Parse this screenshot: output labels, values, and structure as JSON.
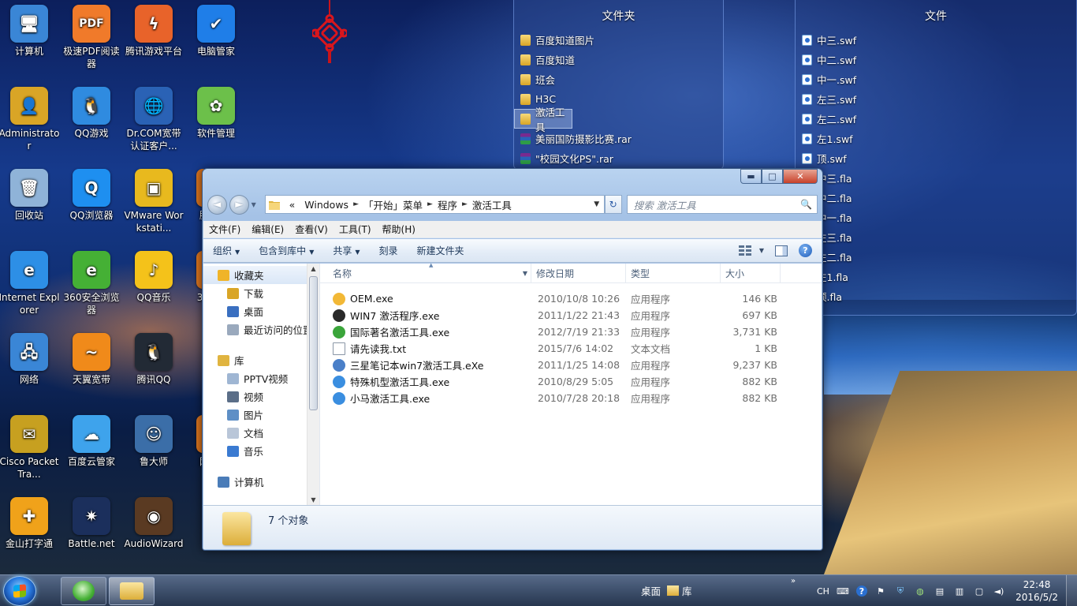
{
  "desktop": {
    "icons": [
      {
        "label": "计算机",
        "icon": "computer-icon",
        "color": "#3a86d6",
        "glyph": "🖥"
      },
      {
        "label": "极速PDF阅读器",
        "icon": "pdf-reader-icon",
        "color": "#f07a2a",
        "glyph": "PDF"
      },
      {
        "label": "腾讯游戏平台",
        "icon": "tencent-games-icon",
        "color": "#e8632a",
        "glyph": "ϟ"
      },
      {
        "label": "电脑管家",
        "icon": "pc-manager-icon",
        "color": "#1f7ee8",
        "glyph": "✔"
      },
      {
        "label": "Administrator",
        "icon": "user-folder-icon",
        "color": "#d9a526",
        "glyph": "👤"
      },
      {
        "label": "QQ游戏",
        "icon": "qq-game-icon",
        "color": "#2f8be0",
        "glyph": "🐧"
      },
      {
        "label": "Dr.COM宽带认证客户...",
        "icon": "drcom-icon",
        "color": "#2a62b5",
        "glyph": "🌐"
      },
      {
        "label": "软件管理",
        "icon": "software-manager-icon",
        "color": "#6cc04a",
        "glyph": "✿"
      },
      {
        "label": "回收站",
        "icon": "recycle-bin-icon",
        "color": "#8fb3d8",
        "glyph": "🗑"
      },
      {
        "label": "QQ浏览器",
        "icon": "qq-browser-icon",
        "color": "#1e8ff0",
        "glyph": "Q"
      },
      {
        "label": "VMware Workstati...",
        "icon": "vmware-icon",
        "color": "#e8b91e",
        "glyph": "▣"
      },
      {
        "label": "Internet Explorer",
        "icon": "ie-icon",
        "color": "#2d8fe6",
        "glyph": "e"
      },
      {
        "label": "360安全浏览器",
        "icon": "360-browser-icon",
        "color": "#45b035",
        "glyph": "e"
      },
      {
        "label": "QQ音乐",
        "icon": "qq-music-icon",
        "color": "#f4c21a",
        "glyph": "♪"
      },
      {
        "label": "网络",
        "icon": "network-icon",
        "color": "#3a86d6",
        "glyph": "🖧"
      },
      {
        "label": "天翼宽带",
        "icon": "tianyi-icon",
        "color": "#f08a1a",
        "glyph": "~"
      },
      {
        "label": "腾讯QQ",
        "icon": "qq-icon",
        "color": "#222a35",
        "glyph": "🐧"
      },
      {
        "label": "Cisco Packet Tra...",
        "icon": "packet-tracer-icon",
        "color": "#c7a020",
        "glyph": "✉"
      },
      {
        "label": "百度云管家",
        "icon": "baidu-cloud-icon",
        "color": "#3ea3ec",
        "glyph": "☁"
      },
      {
        "label": "鲁大师",
        "icon": "ludashi-icon",
        "color": "#3b6ea8",
        "glyph": "☺"
      },
      {
        "label": "金山打字通",
        "icon": "typing-icon",
        "color": "#f0a21a",
        "glyph": "✚"
      },
      {
        "label": "Battle.net",
        "icon": "battlenet-icon",
        "color": "#1b2f5c",
        "glyph": "✷"
      },
      {
        "label": "AudioWizard",
        "icon": "audiowizard-icon",
        "color": "#5a3a22",
        "glyph": "◉"
      }
    ],
    "partial_labels": [
      "腾",
      "36",
      "网"
    ]
  },
  "stack_folders": {
    "title": "文件夹",
    "items": [
      {
        "label": "百度知道图片",
        "type": "folder"
      },
      {
        "label": "百度知道",
        "type": "folder"
      },
      {
        "label": "班会",
        "type": "folder"
      },
      {
        "label": "H3C",
        "type": "folder"
      },
      {
        "label": "激活工具",
        "type": "folder",
        "selected": true
      },
      {
        "label": "美丽国防摄影比赛.rar",
        "type": "rar"
      },
      {
        "label": "\"校园文化PS\".rar",
        "type": "rar"
      }
    ]
  },
  "stack_files": {
    "title": "文件",
    "items": [
      {
        "label": "中三.swf"
      },
      {
        "label": "中二.swf"
      },
      {
        "label": "中一.swf"
      },
      {
        "label": "左三.swf"
      },
      {
        "label": "左二.swf"
      },
      {
        "label": "左1.swf"
      },
      {
        "label": "顶.swf"
      },
      {
        "label": "中三.fla"
      },
      {
        "label": "中二.fla"
      },
      {
        "label": "中一.fla"
      },
      {
        "label": "左三.fla"
      },
      {
        "label": "左二.fla"
      },
      {
        "label": "左1.fla"
      },
      {
        "label": "顶.fla"
      }
    ]
  },
  "explorer": {
    "window_controls": {
      "minimize": "▬",
      "maximize": "□",
      "close": "✕"
    },
    "nav": {
      "back": "◄",
      "forward": "►",
      "history": "▼"
    },
    "address": {
      "prefix": "«",
      "crumbs": [
        "Windows",
        "「开始」菜单",
        "程序",
        "激活工具"
      ],
      "separator": "►",
      "dropdown": "▼",
      "refresh": "↻"
    },
    "search": {
      "placeholder": "搜索 激活工具",
      "icon": "🔍"
    },
    "menu": [
      "文件(F)",
      "编辑(E)",
      "查看(V)",
      "工具(T)",
      "帮助(H)"
    ],
    "commands": [
      {
        "label": "组织",
        "dropdown": true
      },
      {
        "label": "包含到库中",
        "dropdown": true
      },
      {
        "label": "共享",
        "dropdown": true
      },
      {
        "label": "刻录",
        "dropdown": false
      },
      {
        "label": "新建文件夹",
        "dropdown": false
      }
    ],
    "help_label": "?",
    "nav_pane": [
      {
        "label": "收藏夹",
        "icon": "star-icon",
        "indent": 0,
        "color": "#f0b429",
        "selected": true
      },
      {
        "label": "下载",
        "icon": "downloads-icon",
        "indent": 1,
        "color": "#d9a526"
      },
      {
        "label": "桌面",
        "icon": "desktop-icon",
        "indent": 1,
        "color": "#3a6fc0"
      },
      {
        "label": "最近访问的位置",
        "icon": "recent-places-icon",
        "indent": 1,
        "color": "#9aa9bd"
      },
      {
        "label": "",
        "icon": "",
        "indent": 0,
        "spacer": true
      },
      {
        "label": "库",
        "icon": "library-icon",
        "indent": 0,
        "color": "#e0b440"
      },
      {
        "label": "PPTV视频",
        "icon": "pptv-icon",
        "indent": 1,
        "color": "#9fb6d3"
      },
      {
        "label": "视频",
        "icon": "videos-icon",
        "indent": 1,
        "color": "#5b6e88"
      },
      {
        "label": "图片",
        "icon": "pictures-icon",
        "indent": 1,
        "color": "#5e8fc6"
      },
      {
        "label": "文档",
        "icon": "documents-icon",
        "indent": 1,
        "color": "#b9c6d8"
      },
      {
        "label": "音乐",
        "icon": "music-icon",
        "indent": 1,
        "color": "#3a7ad1"
      },
      {
        "label": "",
        "icon": "",
        "indent": 0,
        "spacer": true
      },
      {
        "label": "计算机",
        "icon": "computer-icon",
        "indent": 0,
        "color": "#4a7cb8"
      }
    ],
    "columns": [
      "名称",
      "修改日期",
      "类型",
      "大小"
    ],
    "files": [
      {
        "name": "OEM.exe",
        "date": "2010/10/8 10:26",
        "type": "应用程序",
        "size": "146 KB",
        "icon": "oem-exe-icon",
        "color": "#f2b836"
      },
      {
        "name": "WIN7 激活程序.exe",
        "date": "2011/1/22 21:43",
        "type": "应用程序",
        "size": "697 KB",
        "icon": "win7-activator-icon",
        "color": "#2a2a2a"
      },
      {
        "name": "国际著名激活工具.exe",
        "date": "2012/7/19 21:33",
        "type": "应用程序",
        "size": "3,731 KB",
        "icon": "activator-tool-icon",
        "color": "#3aa53a"
      },
      {
        "name": "请先读我.txt",
        "date": "2015/7/6 14:02",
        "type": "文本文档",
        "size": "1 KB",
        "icon": "text-file-icon",
        "color": "#ffffff"
      },
      {
        "name": "三星笔记本win7激活工具.eXe",
        "date": "2011/1/25 14:08",
        "type": "应用程序",
        "size": "9,237 KB",
        "icon": "samsung-activator-icon",
        "color": "#4a7fc8"
      },
      {
        "name": "特殊机型激活工具.exe",
        "date": "2010/8/29 5:05",
        "type": "应用程序",
        "size": "882 KB",
        "icon": "special-activator-icon",
        "color": "#3a8ee0"
      },
      {
        "name": "小马激活工具.exe",
        "date": "2010/7/28 20:18",
        "type": "应用程序",
        "size": "882 KB",
        "icon": "xiaoma-activator-icon",
        "color": "#3a8ee0"
      }
    ],
    "status": "7 个对象"
  },
  "taskbar": {
    "links": [
      {
        "label": "桌面"
      },
      {
        "label": "库"
      }
    ],
    "links_expand": "»",
    "tray": {
      "input": "CH",
      "items": [
        "keyboard-icon",
        "help-icon",
        "question-icon",
        "shield-icon",
        "globe-icon",
        "monitor-icon",
        "device-icon",
        "network-icon",
        "volume-icon"
      ]
    },
    "time": "22:48",
    "date": "2016/5/2"
  }
}
